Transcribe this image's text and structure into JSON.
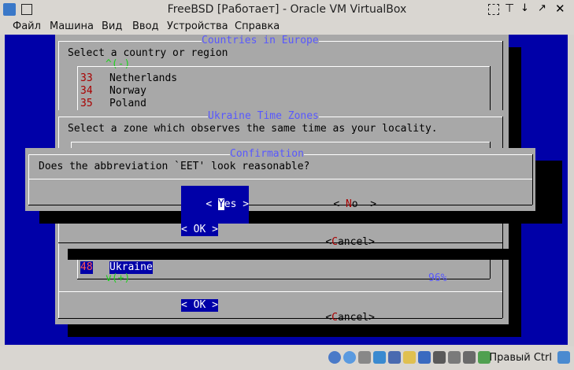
{
  "window": {
    "title": "FreeBSD [Работает] - Oracle VM VirtualBox",
    "host_key_label": "Правый Ctrl"
  },
  "menu": {
    "items": [
      "Файл",
      "Машина",
      "Вид",
      "Ввод",
      "Устройства",
      "Справка"
    ]
  },
  "countries_dialog": {
    "title": "Countries in Europe",
    "prompt": "Select a country or region",
    "scroll_up": "^(-)",
    "rows": [
      {
        "num": "33",
        "name": "Netherlands"
      },
      {
        "num": "34",
        "name": "Norway"
      },
      {
        "num": "35",
        "name": "Poland"
      }
    ],
    "selected": {
      "num": "48",
      "name": "Ukraine"
    },
    "scroll_down": "v(+)",
    "percent": "96%",
    "ok_label": "< OK >",
    "cancel_label_pre": "<",
    "cancel_hot": "C",
    "cancel_rest": "ancel>"
  },
  "timezone_dialog": {
    "title": "Ukraine Time Zones",
    "prompt": "Select a zone which observes the same time as your locality.",
    "ok_label": "< OK >",
    "cancel_label_pre": "<",
    "cancel_hot": "C",
    "cancel_rest": "ancel>"
  },
  "confirm_dialog": {
    "title": "Confirmation",
    "question": "Does the abbreviation `EET' look reasonable?",
    "yes_pre": "< ",
    "yes_hot": "Y",
    "yes_rest": "es >",
    "no_pre": "< ",
    "no_hot": "N",
    "no_rest": "o  >"
  },
  "statusbar": {
    "icons": [
      "hdd-icon",
      "optical-icon",
      "floppy-icon",
      "network-icon",
      "usb-icon",
      "shared-folder-icon",
      "display-icon",
      "recording-icon",
      "keyboard-icon",
      "mouse-icon",
      "cpu-icon",
      "arrow-icon"
    ]
  },
  "colors": {
    "dialog_bg": "#a8a8a8",
    "screen_bg": "#0000a8",
    "title_fg": "#5858ff",
    "hotkey_fg": "#a80000"
  }
}
